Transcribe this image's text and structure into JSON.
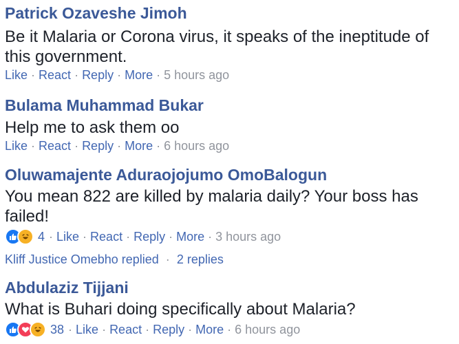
{
  "comments": [
    {
      "author": "Patrick Ozaveshe Jimoh",
      "text": "Be it Malaria or Corona virus, it speaks of the ineptitude of this government.",
      "like": "Like",
      "react": "React",
      "reply": "Reply",
      "more": "More",
      "time": "5 hours ago"
    },
    {
      "author": "Bulama Muhammad Bukar",
      "text": "Help me to ask them oo",
      "like": "Like",
      "react": "React",
      "reply": "Reply",
      "more": "More",
      "time": "6 hours ago"
    },
    {
      "author": "Oluwamajente Aduraojojumo OmoBalogun",
      "text": "You mean 822 are killed by malaria daily? Your boss has failed!",
      "reaction_icons": [
        "like-icon",
        "haha-icon"
      ],
      "reaction_count": "4",
      "like": "Like",
      "react": "React",
      "reply": "Reply",
      "more": "More",
      "time": "3 hours ago",
      "replies": {
        "replier": "Kliff Justice Omebho replied",
        "count": "2 replies"
      }
    },
    {
      "author": "Abdulaziz Tijjani",
      "text": "What is Buhari doing specifically about Malaria?",
      "reaction_icons": [
        "like-icon",
        "love-icon",
        "haha-icon"
      ],
      "reaction_count": "38",
      "like": "Like",
      "react": "React",
      "reply": "Reply",
      "more": "More",
      "time": "6 hours ago"
    }
  ],
  "separator": "·",
  "colors": {
    "author": "#3b5998",
    "link": "#4267b2",
    "muted": "#90949c",
    "text": "#1d2129",
    "like": "#1877f2",
    "love": "#f33e58",
    "haha": "#f7b125"
  }
}
